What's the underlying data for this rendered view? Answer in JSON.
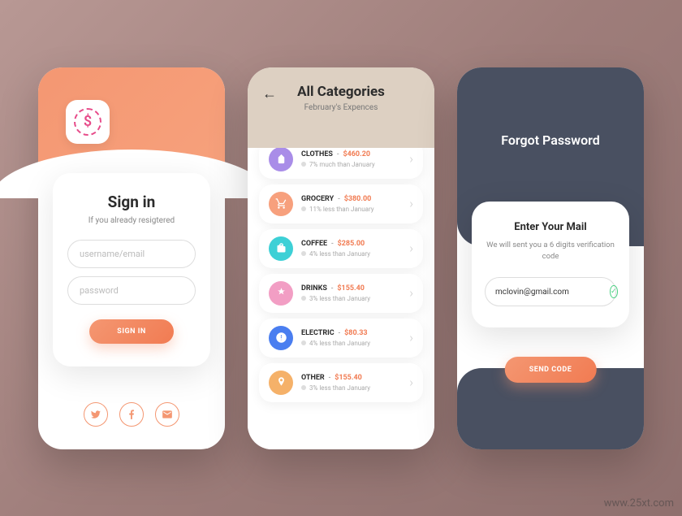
{
  "watermark": "www.25xt.com",
  "signin": {
    "logo": "$",
    "title": "Sign in",
    "subtitle": "If you already resigtered",
    "username_placeholder": "username/email",
    "password_placeholder": "password",
    "button": "SIGN IN"
  },
  "categories": {
    "title": "All Categories",
    "subtitle": "February's Expences",
    "items": [
      {
        "name": "CLOTHES",
        "amount": "$460.20",
        "note": "7% much than January",
        "color": "#a98de8"
      },
      {
        "name": "GROCERY",
        "amount": "$380.00",
        "note": "11% less than January",
        "color": "#f7a07d"
      },
      {
        "name": "COFFEE",
        "amount": "$285.00",
        "note": "4% less than January",
        "color": "#3dd0d6"
      },
      {
        "name": "DRINKS",
        "amount": "$155.40",
        "note": "3% less than January",
        "color": "#f29ec4"
      },
      {
        "name": "ELECTRIC",
        "amount": "$80.33",
        "note": "4% less than January",
        "color": "#4a7ef0"
      },
      {
        "name": "OTHER",
        "amount": "$155.40",
        "note": "3% less than January",
        "color": "#f5b169"
      }
    ]
  },
  "forgot": {
    "title": "Forgot Password",
    "card_title": "Enter Your Mail",
    "card_sub": "We will sent you a 6 digits verification code",
    "email": "mclovin@gmail.com",
    "button": "SEND CODE"
  }
}
